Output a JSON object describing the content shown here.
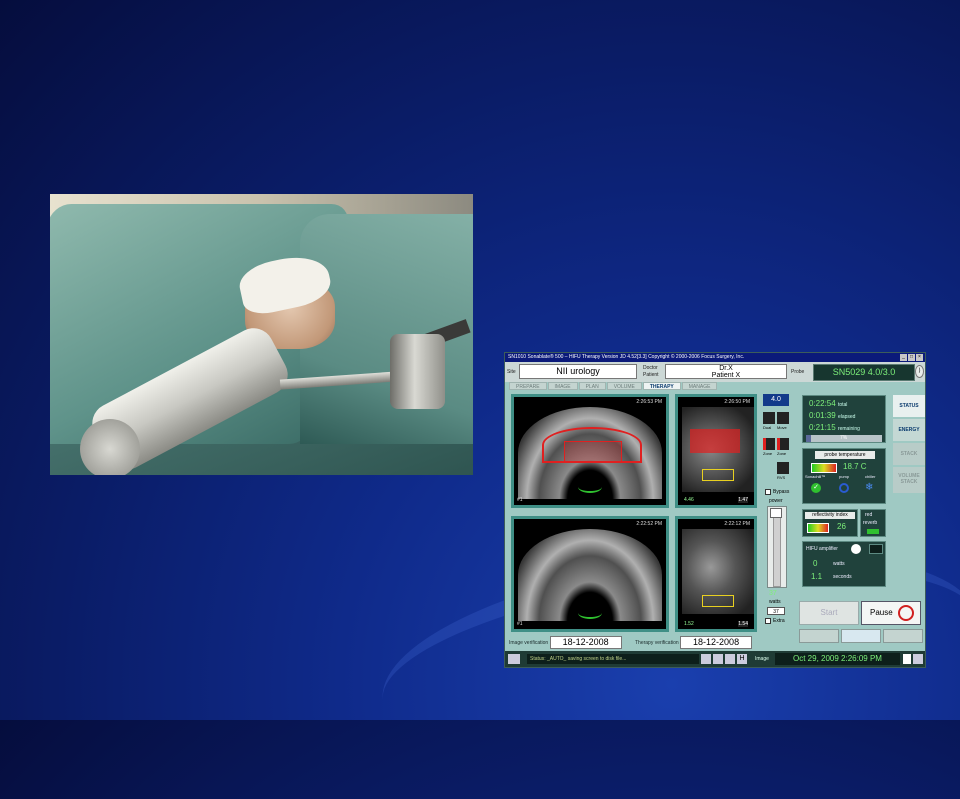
{
  "app": {
    "title": "SN1010  Sonablate® 500 – HIFU Therapy  Version JD 4.52[3.3]  Copyright © 2000-2006 Focus Surgery, Inc.",
    "site_label": "Site",
    "site_value": "NII urology",
    "doctor_label": "Doctor",
    "patient_label": "Patient",
    "doctor_value": "Dr.X",
    "patient_value": "Patient X",
    "probe_label": "Probe",
    "probe_value": "SN5029 4.0/3.0",
    "tabs": [
      "PREPARE",
      "IMAGE",
      "PLAN",
      "VOLUME",
      "THERAPY",
      "MANAGE"
    ],
    "active_tab": "THERAPY",
    "image_timestamps": [
      "2:26:53 PM",
      "2:26:50 PM",
      "2:22:52 PM",
      "2:22:12 PM"
    ],
    "panel_labels": [
      "#1",
      "#2",
      "#1",
      "#2"
    ],
    "sagittal_readout_left": "4.46",
    "sagittal_readout_right": "1.47",
    "sagittal2_readout_left": "1.52",
    "sagittal2_readout_right": "1.54",
    "zoom_value": "4.0",
    "image_verification_label": "Image verification",
    "image_verification_date": "18-12-2008",
    "therapy_verification_label": "Therapy verification",
    "therapy_verification_date": "18-12-2008",
    "ctrl_labels": [
      "Dual",
      "Move",
      "Zone",
      "Zone",
      "RVS"
    ],
    "bypass_label": "Bypass",
    "power_label": "power",
    "power_value": "37",
    "watts_label": "watts",
    "power_box": "37",
    "extra_label": "Extra",
    "timer_total": "0:22:54",
    "timer_total_label": "total",
    "timer_elapsed": "0:01:39",
    "timer_elapsed_label": "elapsed",
    "timer_remaining": "0:21:15",
    "timer_remaining_label": "remaining",
    "progress_percent": "7%",
    "progress_fraction": 0.07,
    "probe_temp_label": "probe temperature",
    "probe_temp_value": "18.7 C",
    "sonachill_label": "Sonachill™",
    "pump_label": "pump",
    "chiller_label": "chiller",
    "reflectivity_label": "reflectivity index",
    "reflectivity_value": "26",
    "red_label": "red",
    "reverb_label": "reverb",
    "hifu_amp_label": "HIFU amplifier",
    "hifu_watts_value": "0",
    "hifu_watts_label": "watts",
    "hifu_seconds_value": "1.1",
    "hifu_seconds_label": "seconds",
    "side_tabs": [
      "STATUS",
      "ENERGY",
      "STACK",
      "VOLUME STACK"
    ],
    "start_label": "Start",
    "pause_label": "Pause",
    "status_label": "Status",
    "status_message": "_AUTO_ saving screen to disk file...",
    "image_label": "Image",
    "date_value": "Oct 29, 2009 2:26:09 PM"
  },
  "colors": {
    "slide_bg": "#0a1c66",
    "app_bg": "#9fc9c3",
    "panel_border": "#3f8f86",
    "readout_green": "#7df07a",
    "lesion_red": "#e02020"
  }
}
